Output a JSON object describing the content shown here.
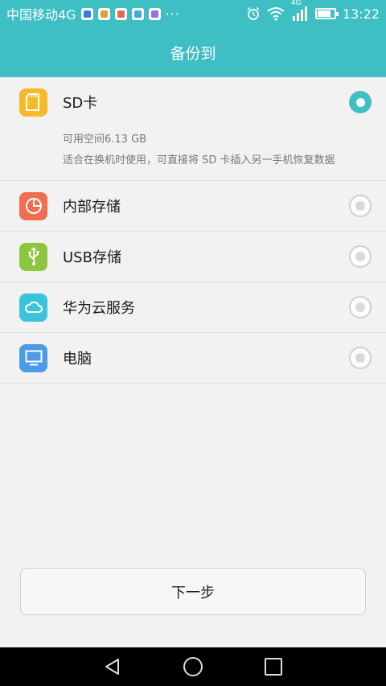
{
  "status_bar": {
    "carrier": "中国移动4G",
    "more": "···",
    "network": "4G",
    "time": "13:22",
    "battery_level": 0.8,
    "app_icon_colors": [
      "#2f7ee0",
      "#d9a23a",
      "#e06a5a",
      "#40a8d8",
      "#9b6fe0"
    ]
  },
  "title": "备份到",
  "options": [
    {
      "label": "SD卡",
      "icon": "sd-card-icon",
      "color": "#f7b829",
      "selected": true,
      "capacity": "可用空间6.13 GB",
      "description": "适合在换机时使用，可直接将 SD 卡插入另一手机恢复数据"
    },
    {
      "label": "内部存储",
      "icon": "internal-storage-icon",
      "color": "#f26d4f",
      "selected": false
    },
    {
      "label": "USB存储",
      "icon": "usb-icon",
      "color": "#8cc63e",
      "selected": false
    },
    {
      "label": "华为云服务",
      "icon": "cloud-icon",
      "color": "#3cc3dc",
      "selected": false
    },
    {
      "label": "电脑",
      "icon": "computer-icon",
      "color": "#4c9be6",
      "selected": false
    }
  ],
  "next_button": "下一步",
  "navigation": [
    "back-icon",
    "home-icon",
    "recents-icon"
  ],
  "accent_color": "#3ebfc4"
}
